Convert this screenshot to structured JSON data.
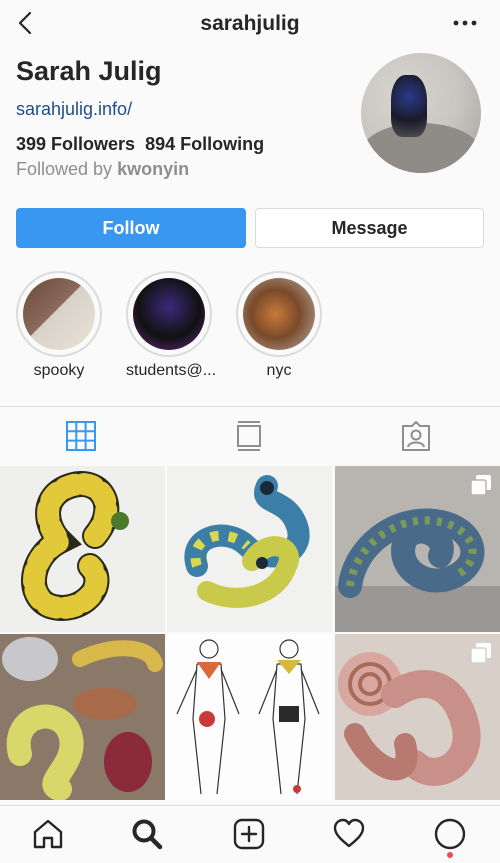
{
  "header": {
    "username": "sarahjulig"
  },
  "profile": {
    "name": "Sarah Julig",
    "website": "sarahjulig.info/",
    "followers": "399 Followers",
    "following": "894 Following",
    "followed_by_prefix": "Followed by",
    "followed_by_user": "kwonyin"
  },
  "actions": {
    "follow_label": "Follow",
    "message_label": "Message"
  },
  "highlights": [
    {
      "label": "spooky"
    },
    {
      "label": "students@..."
    },
    {
      "label": "nyc"
    }
  ],
  "tabs": [
    "grid-icon",
    "feed-icon",
    "tagged-icon"
  ],
  "nav": [
    "home-icon",
    "search-icon",
    "new-post-icon",
    "activity-icon",
    "profile-icon"
  ],
  "colors": {
    "accent": "#3897f0",
    "link": "#1f4e8c",
    "notification": "#ed4956"
  }
}
